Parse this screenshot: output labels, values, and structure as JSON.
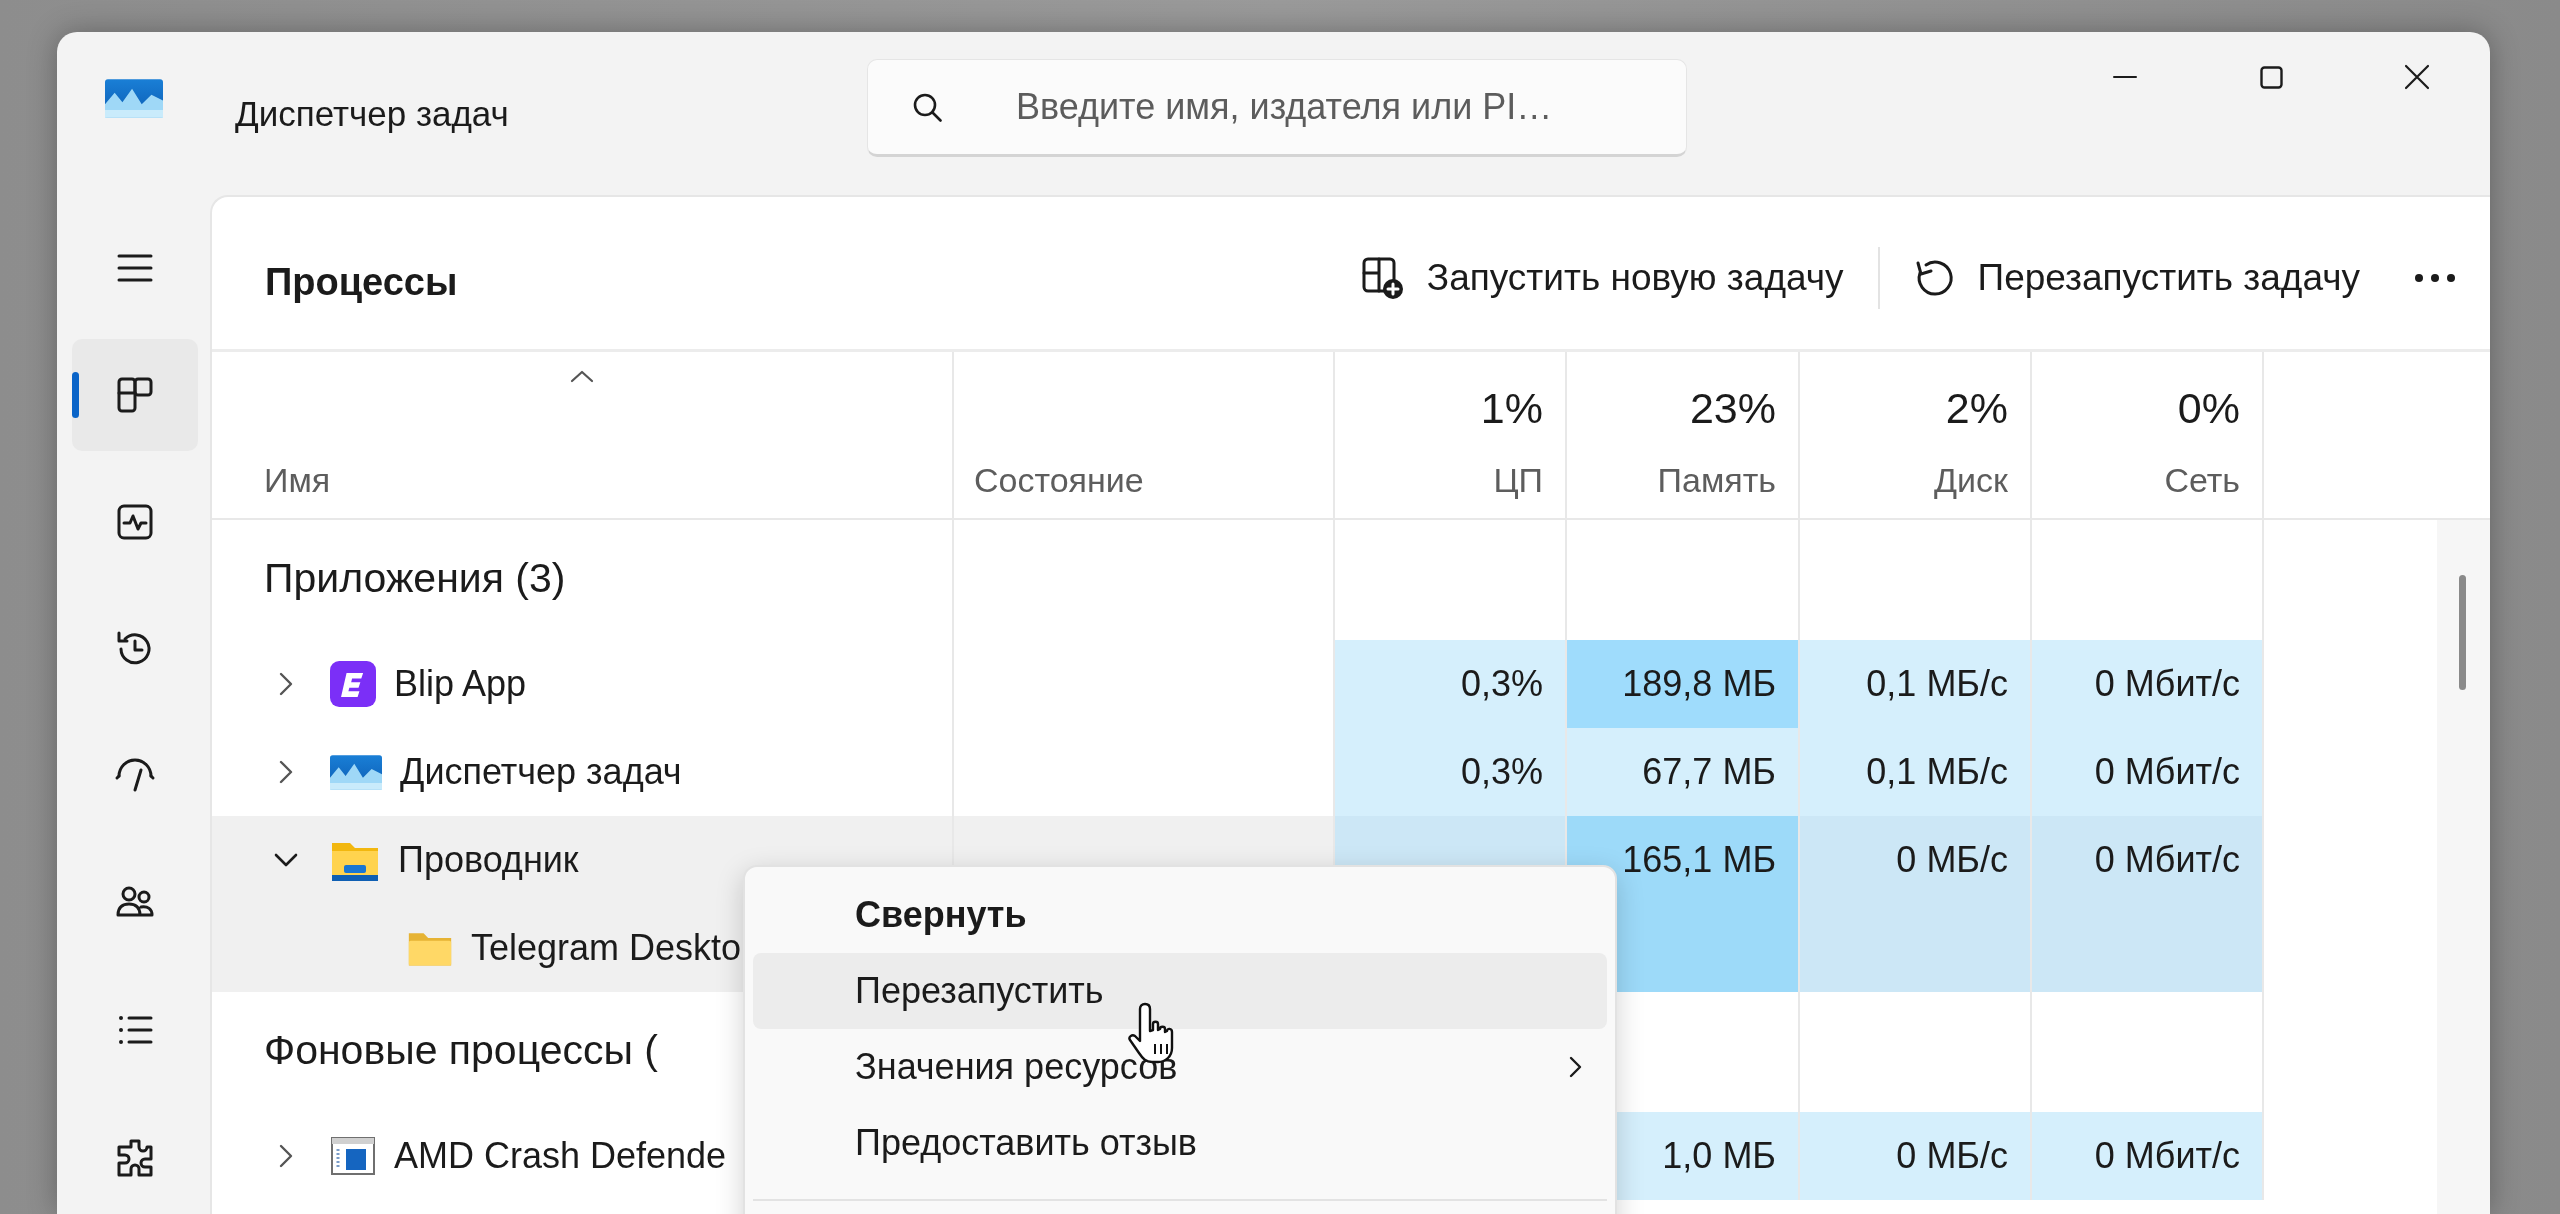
{
  "window": {
    "title": "Диспетчер задач"
  },
  "search": {
    "placeholder": "Введите имя, издателя или PI…"
  },
  "sidebar": {
    "items": [
      {
        "kind": "menu",
        "selected": false
      },
      {
        "kind": "processes",
        "selected": true
      },
      {
        "kind": "performance",
        "selected": false
      },
      {
        "kind": "history",
        "selected": false
      },
      {
        "kind": "startup",
        "selected": false
      },
      {
        "kind": "users",
        "selected": false
      },
      {
        "kind": "details",
        "selected": false
      },
      {
        "kind": "services",
        "selected": false
      }
    ]
  },
  "page": {
    "title": "Процессы",
    "actions": [
      {
        "kind": "run",
        "label": "Запустить новую задачу"
      },
      {
        "kind": "restart",
        "label": "Перезапустить задачу"
      },
      {
        "kind": "more"
      }
    ]
  },
  "table": {
    "columns": [
      {
        "label": "Имя",
        "sorted": true
      },
      {
        "label": "Состояние",
        "sorted": false
      },
      {
        "label": "ЦП",
        "total": "1%",
        "sorted": false
      },
      {
        "label": "Память",
        "total": "23%",
        "sorted": false
      },
      {
        "label": "Диск",
        "total": "2%",
        "sorted": false
      },
      {
        "label": "Сеть",
        "total": "0%",
        "sorted": false
      }
    ],
    "groups": [
      {
        "title": "Приложения (3)",
        "rows": [
          {
            "name": "Blip App",
            "kind": "blip",
            "expanded": false,
            "selected": false,
            "cells": {
              "cpu": {
                "text": "0,3%",
                "color": "#d5effc"
              },
              "memory": {
                "text": "189,8 МБ",
                "color": "#9fdcfc"
              },
              "disk": {
                "text": "0,1 МБ/с",
                "color": "#d5effc"
              },
              "network": {
                "text": "0 Мбит/с",
                "color": "#d5effc"
              }
            }
          },
          {
            "name": "Диспетчер задач",
            "kind": "taskmgr",
            "expanded": false,
            "selected": false,
            "cells": {
              "cpu": {
                "text": "0,3%",
                "color": "#d5effc"
              },
              "memory": {
                "text": "67,7 МБ",
                "color": "#d5effc"
              },
              "disk": {
                "text": "0,1 МБ/с",
                "color": "#d5effc"
              },
              "network": {
                "text": "0 Мбит/с",
                "color": "#d5effc"
              }
            }
          },
          {
            "name": "Проводник",
            "kind": "explorer",
            "expanded": true,
            "selected": true,
            "cells": {
              "cpu": {
                "color": "#cce7f6"
              },
              "memory": {
                "text": "165,1 МБ",
                "color": "#9ddaf9"
              },
              "disk": {
                "text": "0 МБ/с",
                "color": "#cce7f6"
              },
              "network": {
                "text": "0 Мбит/с",
                "color": "#cce7f6"
              }
            },
            "children": [
              {
                "name": "Telegram Deskto",
                "kind": "folder",
                "selected": true,
                "cells": {
                  "memory": {
                    "color": "#9ddaf9"
                  },
                  "disk": {
                    "color": "#cce7f6"
                  },
                  "network": {
                    "color": "#cce7f6"
                  }
                }
              }
            ]
          }
        ]
      },
      {
        "title": "Фоновые процессы (",
        "rows": [
          {
            "name": "AMD Crash Defende",
            "kind": "window",
            "expanded": false,
            "selected": false,
            "cells": {
              "memory": {
                "text": "1,0 МБ",
                "color": "#d5effc"
              },
              "disk": {
                "text": "0 МБ/с",
                "color": "#d5effc"
              },
              "network": {
                "text": "0 Мбит/с",
                "color": "#d5effc"
              }
            }
          }
        ]
      }
    ]
  },
  "context_menu": {
    "items": [
      {
        "label": "Свернуть",
        "default": true,
        "highlighted": false,
        "submenu": false
      },
      {
        "label": "Перезапустить",
        "default": false,
        "highlighted": true,
        "submenu": false
      },
      {
        "label": "Значения ресурсов",
        "default": false,
        "highlighted": false,
        "submenu": true
      },
      {
        "label": "Предоставить отзыв",
        "default": false,
        "highlighted": false,
        "submenu": false
      }
    ]
  }
}
